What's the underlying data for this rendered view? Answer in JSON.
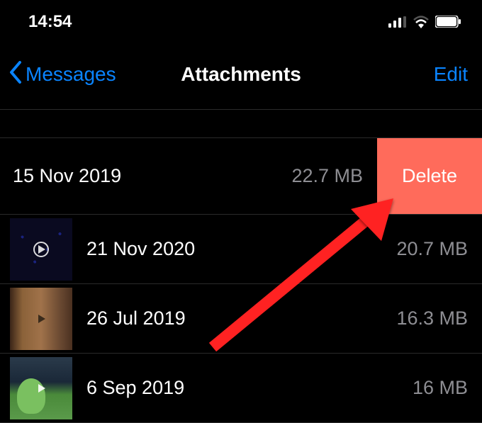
{
  "status": {
    "time": "14:54"
  },
  "nav": {
    "back_label": "Messages",
    "title": "Attachments",
    "edit_label": "Edit"
  },
  "swiped": {
    "date": "15 Nov 2019",
    "size": "22.7 MB",
    "delete_label": "Delete"
  },
  "rows": [
    {
      "date": "21 Nov 2020",
      "size": "20.7 MB"
    },
    {
      "date": "26 Jul 2019",
      "size": "16.3 MB"
    },
    {
      "date": "6 Sep 2019",
      "size": "16 MB"
    }
  ],
  "colors": {
    "accent": "#0a84ff",
    "delete": "#ff6b5b",
    "arrow": "#ff2020"
  }
}
